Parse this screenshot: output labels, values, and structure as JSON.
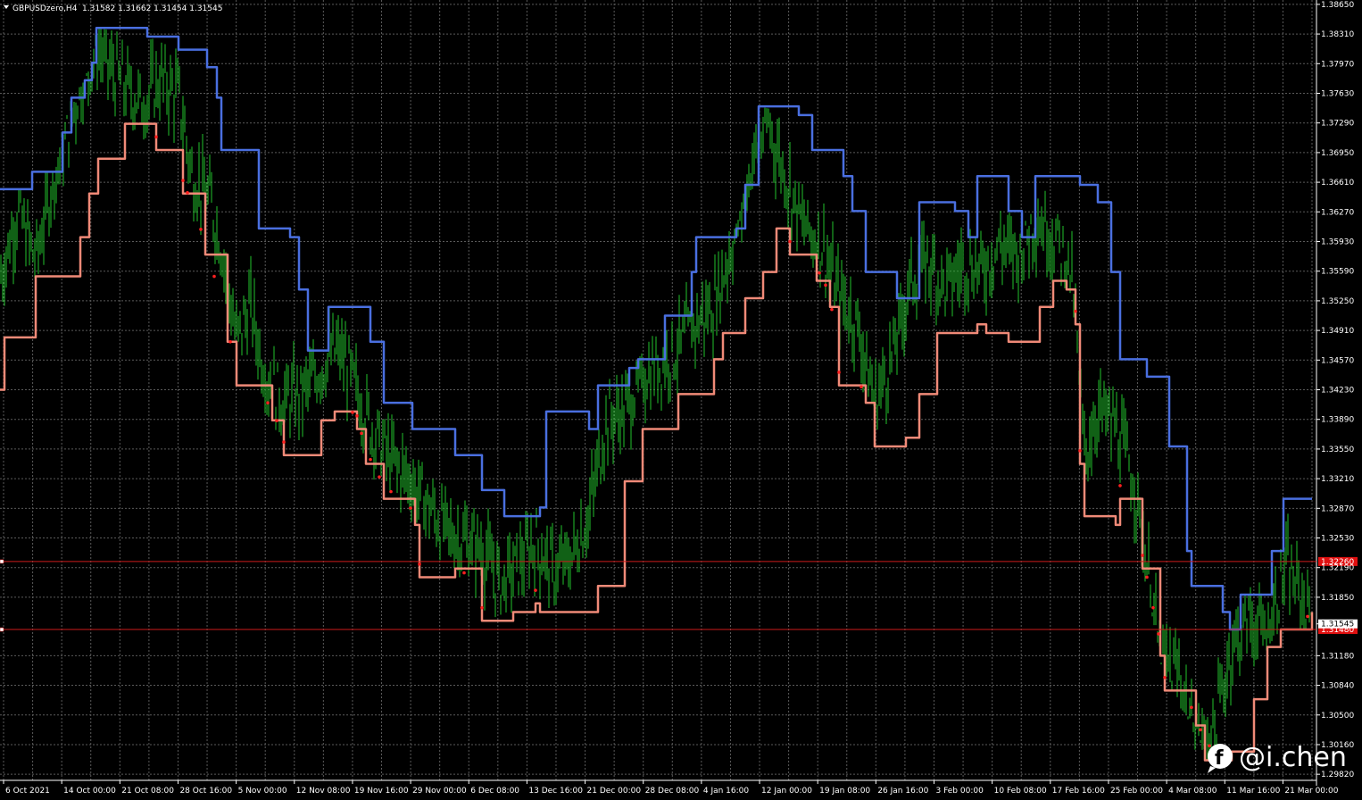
{
  "header": {
    "symbol": "GBPUSDzero,H4",
    "ohlc": "1.31582 1.31662 1.31454 1.31545"
  },
  "watermark": {
    "text": "@i.chen",
    "icon": "bubble-f-icon"
  },
  "colors": {
    "background": "#000000",
    "grid": "#5a5a5a",
    "candle": "#22c22c",
    "upper_band": "#4a6fe0",
    "lower_band": "#f08a78",
    "marker": "#ff2020",
    "hline": "#cc1a1a",
    "tag_bg": "#e01010",
    "price_tag_bg": "#ffffff"
  },
  "chart_data": {
    "type": "line",
    "title": "GBPUSDzero,H4",
    "grid": true,
    "ylim": [
      1.2975,
      1.387
    ],
    "y_ticks": [
      "1.38650",
      "1.38310",
      "1.37970",
      "1.37630",
      "1.37290",
      "1.36950",
      "1.36610",
      "1.36270",
      "1.35930",
      "1.35590",
      "1.35250",
      "1.34910",
      "1.34570",
      "1.34230",
      "1.33890",
      "1.33550",
      "1.33210",
      "1.32870",
      "1.32530",
      "1.32190",
      "1.31850",
      "1.31545",
      "1.31180",
      "1.30840",
      "1.30500",
      "1.30160",
      "1.29820"
    ],
    "x_ticks": [
      "6 Oct 2021",
      "14 Oct 00:00",
      "21 Oct 08:00",
      "28 Oct 16:00",
      "5 Nov 00:00",
      "12 Nov 08:00",
      "19 Nov 16:00",
      "29 Nov 00:00",
      "6 Dec 08:00",
      "13 Dec 16:00",
      "21 Dec 00:00",
      "28 Dec 08:00",
      "4 Jan 16:00",
      "12 Jan 00:00",
      "19 Jan 08:00",
      "26 Jan 16:00",
      "3 Feb 00:00",
      "10 Feb 08:00",
      "17 Feb 16:00",
      "25 Feb 00:00",
      "4 Mar 08:00",
      "11 Mar 16:00",
      "21 Mar 00:00"
    ],
    "x_start": 0,
    "x_end": 1470,
    "series": [
      {
        "kind": "close",
        "x": [
          0,
          20,
          40,
          60,
          75,
          90,
          110,
          125,
          140,
          160,
          180,
          200,
          215,
          235,
          250,
          265,
          280,
          300,
          320,
          340,
          360,
          380,
          400,
          420,
          440,
          460,
          480,
          500,
          520,
          540,
          560,
          580,
          600,
          620,
          640,
          660,
          680,
          700,
          720,
          740,
          760,
          780,
          800,
          820,
          840,
          860,
          880,
          900,
          920,
          940,
          960,
          980,
          1000,
          1020,
          1040,
          1060,
          1080,
          1100,
          1120,
          1140,
          1160,
          1180,
          1200,
          1215,
          1230,
          1250,
          1270,
          1290,
          1300,
          1320,
          1340,
          1360,
          1380,
          1400,
          1420,
          1440,
          1460,
          1470
        ],
        "values": [
          1.355,
          1.363,
          1.357,
          1.367,
          1.372,
          1.377,
          1.382,
          1.379,
          1.377,
          1.375,
          1.378,
          1.376,
          1.367,
          1.364,
          1.358,
          1.348,
          1.352,
          1.343,
          1.341,
          1.342,
          1.345,
          1.347,
          1.342,
          1.337,
          1.334,
          1.332,
          1.329,
          1.326,
          1.325,
          1.324,
          1.32,
          1.322,
          1.325,
          1.321,
          1.323,
          1.328,
          1.339,
          1.34,
          1.344,
          1.345,
          1.347,
          1.35,
          1.352,
          1.359,
          1.368,
          1.373,
          1.367,
          1.361,
          1.359,
          1.353,
          1.35,
          1.341,
          1.346,
          1.355,
          1.357,
          1.354,
          1.357,
          1.356,
          1.359,
          1.358,
          1.362,
          1.36,
          1.356,
          1.335,
          1.34,
          1.338,
          1.332,
          1.319,
          1.311,
          1.31,
          1.301,
          1.303,
          1.313,
          1.316,
          1.314,
          1.322,
          1.318,
          1.3155
        ]
      },
      {
        "kind": "upper",
        "x": [
          0,
          30,
          36,
          62,
          70,
          80,
          95,
          103,
          108,
          165,
          200,
          232,
          243,
          248,
          290,
          325,
          335,
          345,
          368,
          415,
          430,
          462,
          510,
          540,
          565,
          605,
          612,
          660,
          670,
          705,
          715,
          745,
          775,
          780,
          825,
          835,
          850,
          895,
          910,
          945,
          955,
          970,
          1005,
          1030,
          1070,
          1085,
          1095,
          1130,
          1145,
          1160,
          1210,
          1230,
          1245,
          1255,
          1285,
          1310,
          1330,
          1335,
          1370,
          1378,
          1390,
          1425,
          1438,
          1470
        ],
        "values": [
          1.3653,
          1.3653,
          1.3673,
          1.3673,
          1.3718,
          1.3758,
          1.3778,
          1.3798,
          1.3838,
          1.3828,
          1.3813,
          1.3793,
          1.3758,
          1.3698,
          1.3608,
          1.3598,
          1.3538,
          1.3468,
          1.3518,
          1.3478,
          1.3408,
          1.3378,
          1.3348,
          1.3308,
          1.3278,
          1.3288,
          1.3398,
          1.3378,
          1.3428,
          1.3448,
          1.3458,
          1.3508,
          1.3558,
          1.3598,
          1.3608,
          1.3658,
          1.3748,
          1.3738,
          1.3698,
          1.3668,
          1.3628,
          1.3558,
          1.3528,
          1.3638,
          1.3628,
          1.3598,
          1.3668,
          1.3628,
          1.3598,
          1.3668,
          1.3658,
          1.3638,
          1.3558,
          1.3458,
          1.3438,
          1.3358,
          1.3238,
          1.3198,
          1.3168,
          1.3148,
          1.3188,
          1.3238,
          1.3298,
          1.3298
        ]
      },
      {
        "kind": "lower",
        "x": [
          0,
          5,
          40,
          90,
          100,
          110,
          140,
          175,
          205,
          230,
          255,
          265,
          305,
          318,
          360,
          375,
          400,
          410,
          430,
          465,
          470,
          510,
          540,
          575,
          600,
          605,
          670,
          700,
          720,
          760,
          800,
          810,
          835,
          855,
          870,
          885,
          915,
          930,
          940,
          970,
          980,
          1015,
          1030,
          1050,
          1095,
          1105,
          1130,
          1165,
          1180,
          1195,
          1205,
          1210,
          1215,
          1250,
          1255,
          1280,
          1300,
          1305,
          1340,
          1350,
          1380,
          1405,
          1420,
          1435,
          1465,
          1470
        ],
        "values": [
          1.3423,
          1.3483,
          1.3553,
          1.3598,
          1.3648,
          1.3688,
          1.3728,
          1.3698,
          1.3648,
          1.3578,
          1.3478,
          1.3428,
          1.3388,
          1.3348,
          1.3388,
          1.3398,
          1.3378,
          1.3338,
          1.3298,
          1.3268,
          1.3208,
          1.3218,
          1.3158,
          1.3168,
          1.3178,
          1.3168,
          1.3198,
          1.3318,
          1.3378,
          1.3418,
          1.3458,
          1.3488,
          1.3528,
          1.3558,
          1.3608,
          1.3578,
          1.3548,
          1.3518,
          1.3428,
          1.3408,
          1.3358,
          1.3368,
          1.3418,
          1.3488,
          1.3498,
          1.3488,
          1.3478,
          1.3518,
          1.3548,
          1.3538,
          1.3498,
          1.3338,
          1.3278,
          1.3268,
          1.3298,
          1.3218,
          1.3118,
          1.3078,
          1.3038,
          1.2998,
          1.3008,
          1.3068,
          1.3128,
          1.3148,
          1.3148,
          1.3168
        ]
      }
    ],
    "horizontal_lines": [
      {
        "value": 1.3226,
        "tag": "1.32260"
      },
      {
        "value": 1.3148,
        "tag": "1.31480"
      }
    ],
    "current_price": "1.31545"
  }
}
